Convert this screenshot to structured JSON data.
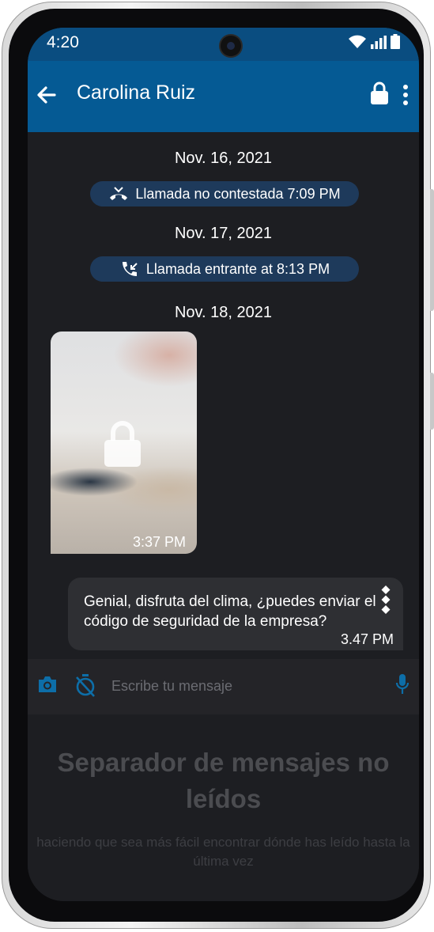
{
  "status_bar": {
    "time": "4:20"
  },
  "header": {
    "contact_name": "Carolina Ruiz",
    "icons": [
      "back-arrow-icon",
      "lock-icon",
      "more-vert-icon"
    ],
    "color": "#055a94"
  },
  "conversation": {
    "dates": [
      "Nov. 16, 2021",
      "Nov. 17, 2021",
      "Nov. 18, 2021"
    ],
    "calls": [
      {
        "icon": "missed-call-icon",
        "label": "Llamada no contestada 7:09 PM"
      },
      {
        "icon": "incoming-call-icon",
        "label": "Llamada entrante at 8:13 PM"
      }
    ],
    "photo_message": {
      "time": "3:37 PM",
      "icon": "lock-icon"
    },
    "text_message": {
      "text": "Genial, disfruta del clima, ¿puedes enviar el código de seguridad de la empresa?",
      "time": "3.47 PM"
    }
  },
  "composer": {
    "placeholder": "Escribe tu mensaje",
    "icons": [
      "camera-icon",
      "timer-off-icon",
      "mic-icon"
    ],
    "accent": "#0d6ea8"
  },
  "separator": {
    "title": "Separador de mensajes no leídos",
    "subtitle": "haciendo que sea más fácil encontrar dónde has leído hasta la última vez"
  }
}
